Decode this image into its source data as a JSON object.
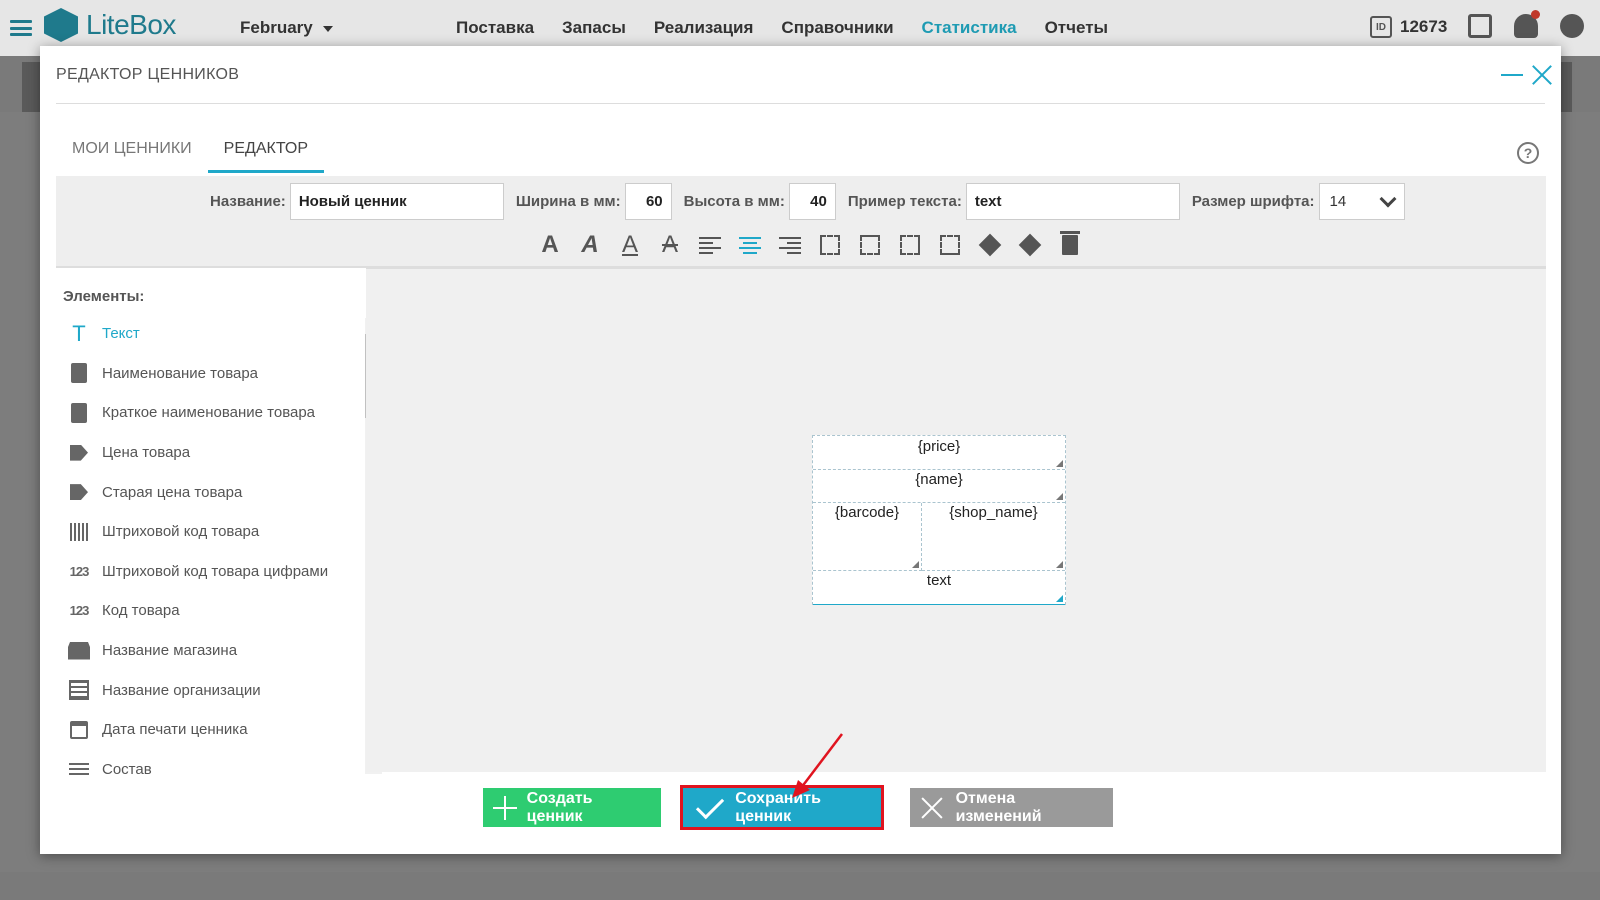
{
  "app": {
    "brand": "LiteBox",
    "period": "February",
    "nav": [
      "Поставка",
      "Запасы",
      "Реализация",
      "Справочники",
      "Статистика",
      "Отчеты"
    ],
    "active_nav_index": 4,
    "account_id": "12673",
    "accent_color": "#1fa8c9"
  },
  "modal": {
    "title": "РЕДАКТОР ЦЕННИКОВ",
    "tabs": [
      {
        "label": "МОИ ЦЕННИКИ"
      },
      {
        "label": "РЕДАКТОР"
      }
    ],
    "active_tab_index": 1,
    "help_label": "?",
    "fields": {
      "name_label": "Название:",
      "name_value": "Новый ценник",
      "width_label": "Ширина в мм:",
      "width_value": "60",
      "height_label": "Высота в мм:",
      "height_value": "40",
      "sample_label": "Пример текста:",
      "sample_value": "text",
      "font_size_label": "Размер шрифта:",
      "font_size_value": "14"
    },
    "format_buttons": {
      "bold": "A",
      "italic": "A",
      "underline": "A",
      "strike": "A"
    },
    "active_alignment": "center",
    "elements": {
      "title": "Элементы:",
      "items": [
        {
          "label": "Текст",
          "icon": "text-icon",
          "glyph": "T"
        },
        {
          "label": "Наименование товара",
          "icon": "clipboard-icon"
        },
        {
          "label": "Краткое наименование товара",
          "icon": "clipboard-icon"
        },
        {
          "label": "Цена товара",
          "icon": "tag-icon"
        },
        {
          "label": "Старая цена товара",
          "icon": "tag-percent-icon"
        },
        {
          "label": "Штриховой код товара",
          "icon": "barcode-icon"
        },
        {
          "label": "Штриховой код товара цифрами",
          "icon": "barcode-digits-icon",
          "glyph": "123"
        },
        {
          "label": "Код товара",
          "icon": "numbers-icon",
          "glyph": "123"
        },
        {
          "label": "Название магазина",
          "icon": "store-icon"
        },
        {
          "label": "Название организации",
          "icon": "organization-icon"
        },
        {
          "label": "Дата печати ценника",
          "icon": "calendar-icon"
        },
        {
          "label": "Состав",
          "icon": "list-icon"
        }
      ],
      "active_index": 0
    },
    "label_preview": {
      "price": "{price}",
      "name": "{name}",
      "barcode": "{barcode}",
      "shop_name": "{shop_name}",
      "text": "text"
    },
    "buttons": {
      "create": "Создать ценник",
      "save": "Сохранить ценник",
      "cancel": "Отмена изменений"
    }
  }
}
